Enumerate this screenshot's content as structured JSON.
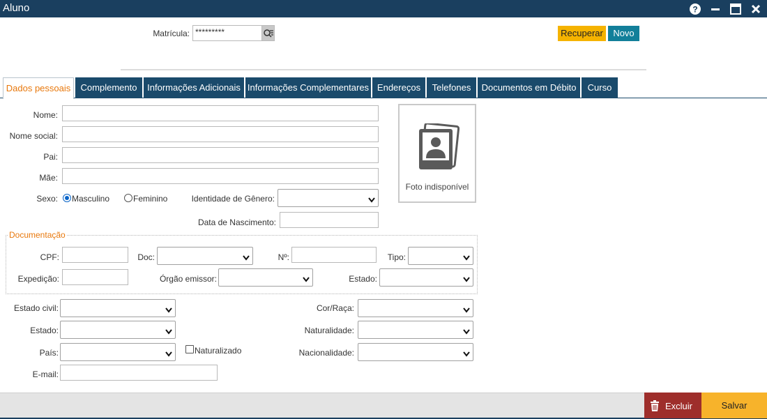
{
  "window": {
    "title": "Aluno"
  },
  "header": {
    "matricula_label": "Matrícula:",
    "matricula_value": "*********",
    "recuperar_label": "Recuperar",
    "novo_label": "Novo"
  },
  "tabs": [
    {
      "label": "Dados pessoais",
      "active": true
    },
    {
      "label": "Complemento"
    },
    {
      "label": "Informações Adicionais"
    },
    {
      "label": "Informações Complementares"
    },
    {
      "label": "Endereços"
    },
    {
      "label": "Telefones"
    },
    {
      "label": "Documentos em Débito"
    },
    {
      "label": "Curso"
    }
  ],
  "form": {
    "nome_label": "Nome:",
    "nome_social_label": "Nome social:",
    "pai_label": "Pai:",
    "mae_label": "Mãe:",
    "sexo_label": "Sexo:",
    "masculino_label": "Masculino",
    "feminino_label": "Feminino",
    "sexo_selected": "Masculino",
    "identidade_genero_label": "Identidade de Gênero:",
    "data_nascimento_label": "Data de Nascimento:",
    "photo_label": "Foto indisponível",
    "documentacao_legend": "Documentação",
    "cpf_label": "CPF:",
    "doc_label": "Doc:",
    "numero_label": "Nº:",
    "tipo_label": "Tipo:",
    "expedicao_label": "Expedição:",
    "orgao_label": "Órgão emissor:",
    "estado_doc_label": "Estado:",
    "estado_civil_label": "Estado civil:",
    "cor_raca_label": "Cor/Raça:",
    "estado_label": "Estado:",
    "naturalidade_label": "Naturalidade:",
    "pais_label": "País:",
    "naturalizado_label": "Naturalizado",
    "nacionalidade_label": "Nacionalidade:",
    "email_label": "E-mail:"
  },
  "footer": {
    "excluir_label": "Excluir",
    "salvar_label": "Salvar"
  },
  "colors": {
    "titlebar": "#1a3f5f",
    "tab": "#1a4a6b",
    "active_tab_text": "#e8780c",
    "recuperar": "#f5b300",
    "novo": "#127f9a",
    "excluir": "#9e2e2b",
    "salvar": "#f7b32b"
  },
  "icons": [
    "help-icon",
    "minimize-icon",
    "maximize-icon",
    "close-icon",
    "search-list-icon",
    "trash-icon",
    "photo-placeholder-icon",
    "chevron-down-icon"
  ]
}
